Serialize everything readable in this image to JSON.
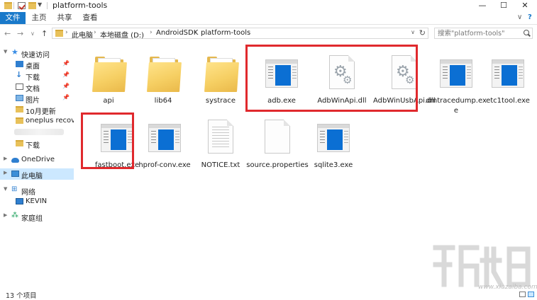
{
  "window": {
    "title": "platform-tools",
    "minimize": "—",
    "maximize": "☐",
    "close": "✕"
  },
  "ribbon": {
    "tabs": [
      "文件",
      "主页",
      "共享",
      "查看"
    ],
    "expand": "∨",
    "help": "?"
  },
  "address": {
    "back": "←",
    "forward": "→",
    "up_arrow": "∨",
    "up": "↑",
    "crumbs": [
      "此电脑",
      "本地磁盘 (D:)",
      "AndroidSDK",
      "platform-tools"
    ],
    "dropdown": "∨",
    "refresh": "↻"
  },
  "search": {
    "placeholder": "搜索\"platform-tools\""
  },
  "sidebar": {
    "items": [
      {
        "label": "快速访问"
      },
      {
        "label": "桌面"
      },
      {
        "label": "下载"
      },
      {
        "label": "文档"
      },
      {
        "label": "图片"
      },
      {
        "label": "10月更新"
      },
      {
        "label": "oneplus recovery"
      },
      {
        "label": ""
      },
      {
        "label": "下载"
      },
      {
        "label": "OneDrive"
      },
      {
        "label": "此电脑"
      },
      {
        "label": "网络"
      },
      {
        "label": "KEVIN"
      },
      {
        "label": "家庭组"
      }
    ]
  },
  "files": [
    {
      "name": "api",
      "type": "folder"
    },
    {
      "name": "lib64",
      "type": "folder"
    },
    {
      "name": "systrace",
      "type": "folder"
    },
    {
      "name": "adb.exe",
      "type": "exe"
    },
    {
      "name": "AdbWinApi.dll",
      "type": "dll"
    },
    {
      "name": "AdbWinUsbApi.dll",
      "type": "dll"
    },
    {
      "name": "dmtracedump.exe",
      "type": "exe"
    },
    {
      "name": "etc1tool.exe",
      "type": "exe"
    },
    {
      "name": "fastboot.exe",
      "type": "exe"
    },
    {
      "name": "hprof-conv.exe",
      "type": "exe"
    },
    {
      "name": "NOTICE.txt",
      "type": "txt"
    },
    {
      "name": "source.properties",
      "type": "file"
    },
    {
      "name": "sqlite3.exe",
      "type": "exe"
    }
  ],
  "status": {
    "count": "13 个项目"
  },
  "watermark": {
    "url": "www.xiazaiba.com"
  },
  "colors": {
    "accent": "#1979ca",
    "highlight": "#e0292d",
    "selection": "#cce8ff"
  }
}
